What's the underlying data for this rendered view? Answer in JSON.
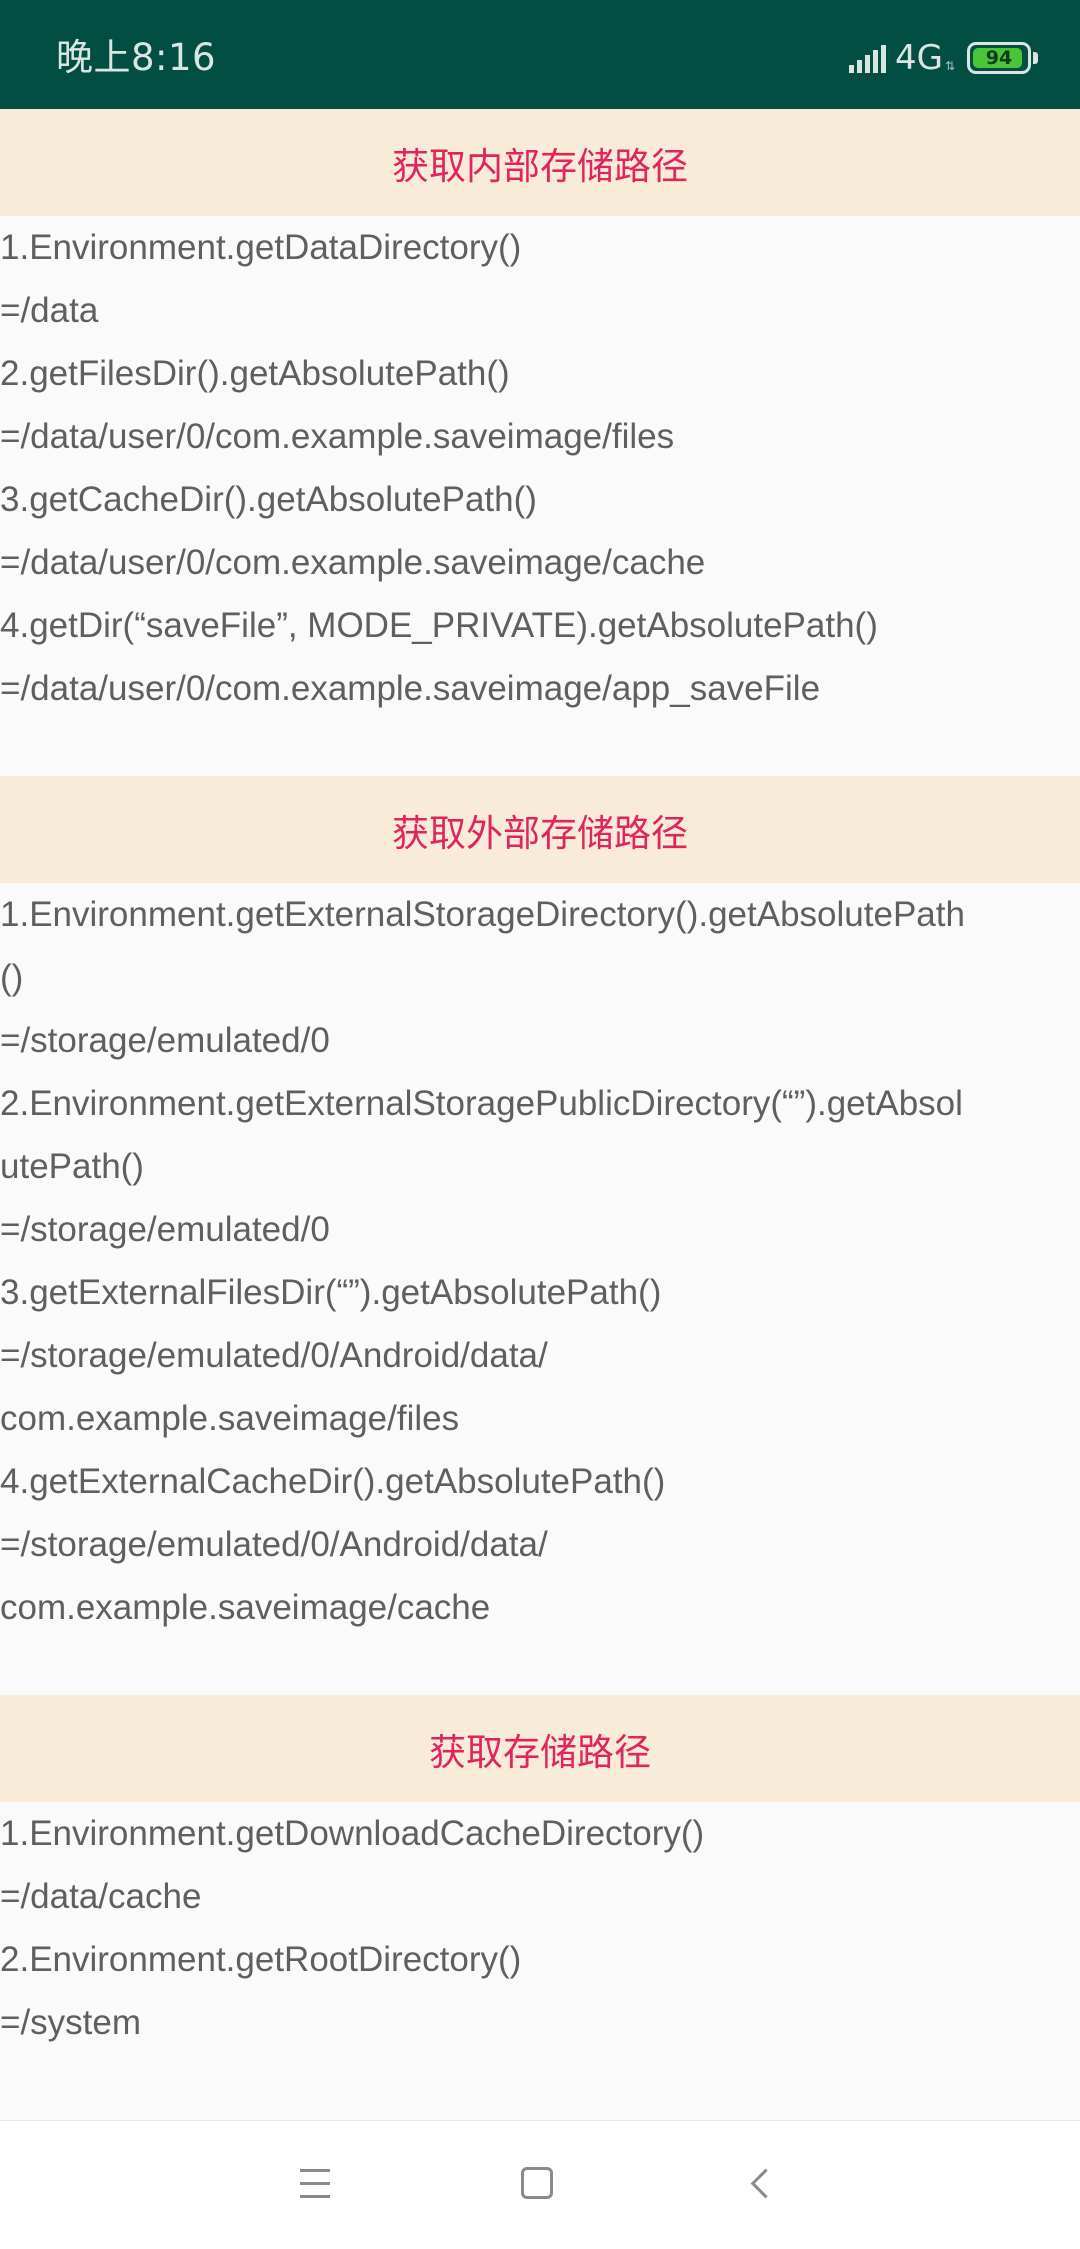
{
  "status_bar": {
    "time": "晚上8:16",
    "network": "4G",
    "network_arrows": "⇅",
    "battery_level": "94",
    "battery_percent": 94,
    "background_color": "#024e43",
    "battery_color": "#4cc43a",
    "icons": [
      "signal-icon",
      "battery-icon"
    ]
  },
  "sections": [
    {
      "title": "获取内部存储路径",
      "lines": [
        "1.Environment.getDataDirectory()",
        "=/data",
        "2.getFilesDir().getAbsolutePath()",
        "=/data/user/0/com.example.saveimage/files",
        "3.getCacheDir().getAbsolutePath()",
        "=/data/user/0/com.example.saveimage/cache",
        "4.getDir(“saveFile”, MODE_PRIVATE).getAbsolutePath()",
        "=/data/user/0/com.example.saveimage/app_saveFile"
      ]
    },
    {
      "title": "获取外部存储路径",
      "lines": [
        "1.Environment.getExternalStorageDirectory().getAbsolutePath",
        "()",
        "=/storage/emulated/0",
        "2.Environment.getExternalStoragePublicDirectory(“”).getAbsol",
        "utePath()",
        "=/storage/emulated/0",
        "3.getExternalFilesDir(“”).getAbsolutePath()",
        "=/storage/emulated/0/Android/data/",
        "com.example.saveimage/files",
        "4.getExternalCacheDir().getAbsolutePath()",
        "=/storage/emulated/0/Android/data/",
        "com.example.saveimage/cache"
      ]
    },
    {
      "title": "获取存储路径",
      "lines": [
        "1.Environment.getDownloadCacheDirectory()",
        "=/data/cache",
        "2.Environment.getRootDirectory()",
        "=/system"
      ]
    }
  ],
  "colors": {
    "header_background": "#f8ecd8",
    "header_text": "#e0245e",
    "body_text": "#5f5f5f",
    "page_background": "#fafafa"
  },
  "nav_bar": {
    "icons": [
      "menu-icon",
      "home-icon",
      "back-icon"
    ]
  }
}
